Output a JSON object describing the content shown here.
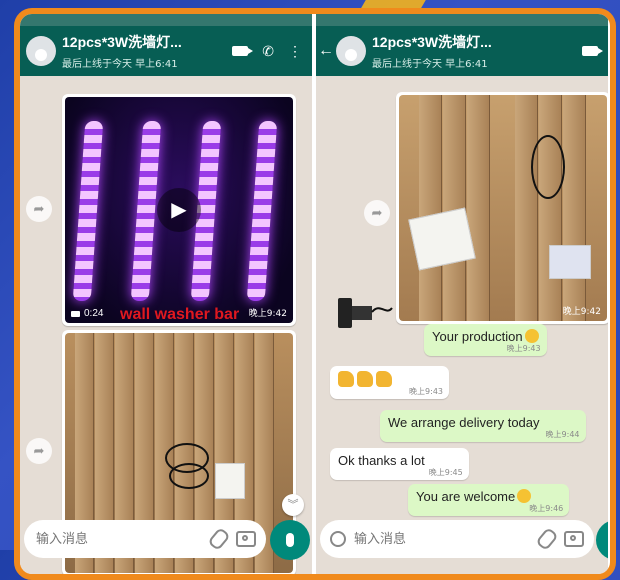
{
  "colors": {
    "header": "#075e54",
    "outgoing": "#dcf8c6",
    "incoming": "#ffffff",
    "frame": "#f08a1c",
    "accent": "#00897b"
  },
  "left": {
    "contact_name": "12pcs*3W洗墙灯...",
    "last_seen": "最后上线于今天 早上6:41",
    "video": {
      "duration": "0:24",
      "time": "晚上9:42"
    },
    "caption": "wall washer bar",
    "input_placeholder": "输入消息"
  },
  "right": {
    "contact_name": "12pcs*3W洗墙灯...",
    "last_seen": "最后上线于今天 早上6:41",
    "photo_time": "晚上9:42",
    "messages": [
      {
        "text": "Your production",
        "time": "晚上9:43",
        "dir": "out"
      },
      {
        "text": "",
        "time": "晚上9:43",
        "dir": "in"
      },
      {
        "text": "We arrange delivery today",
        "time": "晚上9:44",
        "dir": "out"
      },
      {
        "text": "Ok thanks a lot",
        "time": "晚上9:45",
        "dir": "in"
      },
      {
        "text": "You are welcome",
        "time": "晚上9:46",
        "dir": "out"
      }
    ],
    "input_placeholder": "输入消息"
  },
  "icons": [
    "back-arrow-icon",
    "video-call-icon",
    "phone-icon",
    "more-icon",
    "forward-icon",
    "play-icon",
    "attach-icon",
    "camera-icon",
    "mic-icon",
    "emoji-icon",
    "scroll-down-icon",
    "smiley-emoji-icon",
    "thumbs-up-icon"
  ]
}
